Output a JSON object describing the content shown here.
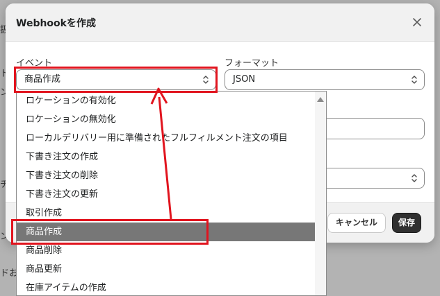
{
  "background": {
    "fragments": [
      {
        "text": "扱"
      },
      {
        "text": "ト"
      },
      {
        "text": "ン"
      },
      {
        "text": "チ"
      },
      {
        "text": "ン"
      },
      {
        "text": "ドお"
      }
    ]
  },
  "modal": {
    "title": "Webhookを作成",
    "event": {
      "label": "イベント",
      "value": "商品作成"
    },
    "format": {
      "label": "フォーマット",
      "value": "JSON"
    },
    "footer": {
      "cancel_label": "キャンセル",
      "save_label": "保存"
    }
  },
  "dropdown": {
    "items": [
      {
        "label": "ロケーションの有効化"
      },
      {
        "label": "ロケーションの無効化"
      },
      {
        "label": "ローカルデリバリー用に準備されたフルフィルメント注文の項目"
      },
      {
        "label": "下書き注文の作成"
      },
      {
        "label": "下書き注文の削除"
      },
      {
        "label": "下書き注文の更新"
      },
      {
        "label": "取引作成"
      },
      {
        "label": "商品作成"
      },
      {
        "label": "商品削除"
      },
      {
        "label": "商品更新"
      },
      {
        "label": "在庫アイテムの作成"
      }
    ],
    "selected_index": 7
  },
  "colors": {
    "highlight": "#e1141e",
    "selected_bg": "#777777",
    "primary_button": "#303030"
  }
}
